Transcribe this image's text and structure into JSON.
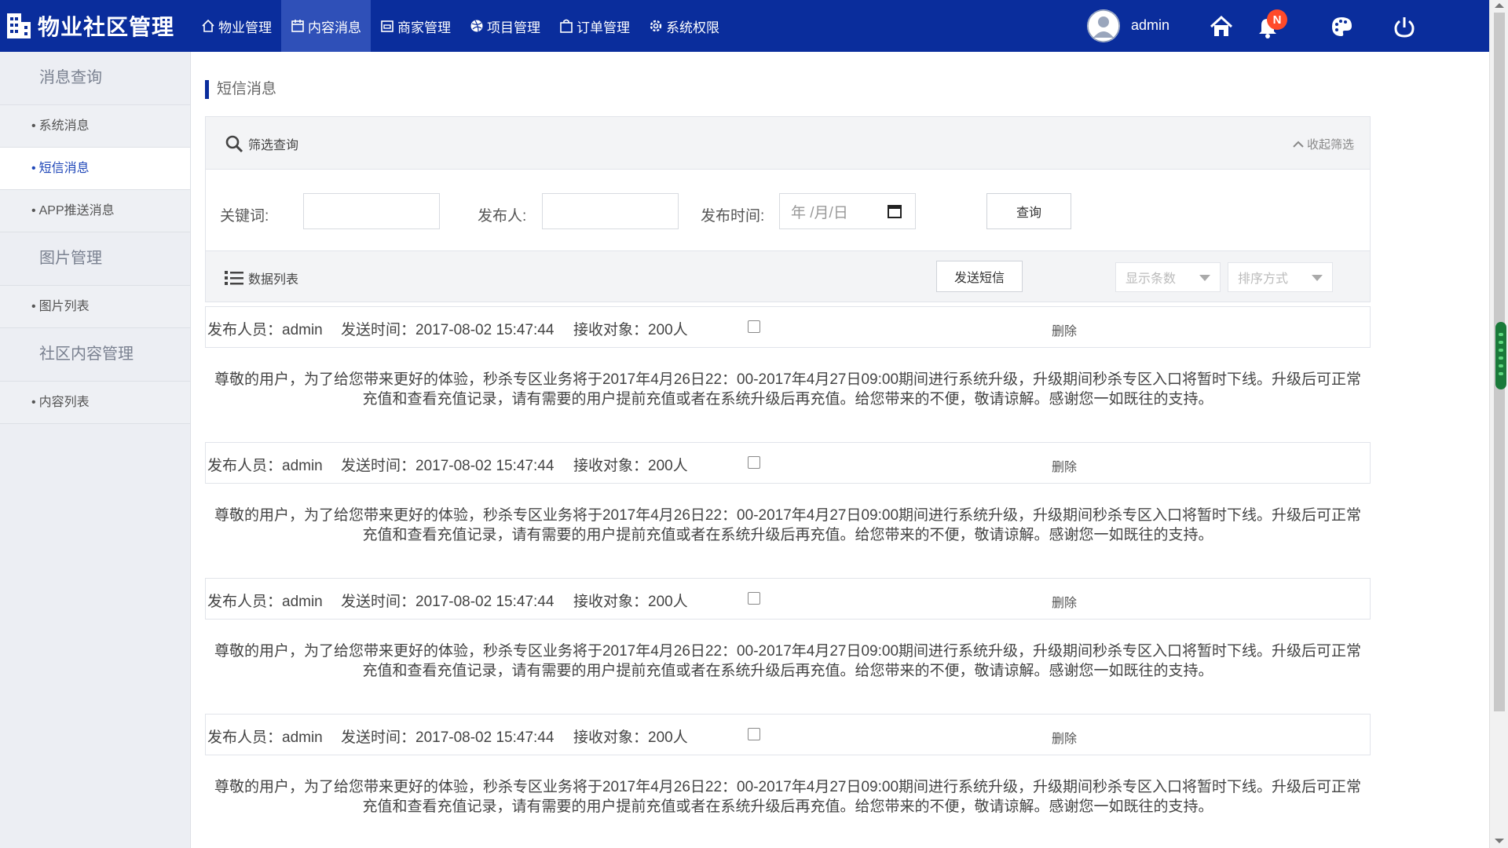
{
  "brand": {
    "title": "物业社区管理"
  },
  "nav": [
    {
      "label": "物业管理",
      "icon": "home-outline-icon"
    },
    {
      "label": "内容消息",
      "icon": "calendar-icon",
      "active": true
    },
    {
      "label": "商家管理",
      "icon": "store-icon"
    },
    {
      "label": "项目管理",
      "icon": "dribbble-icon"
    },
    {
      "label": "订单管理",
      "icon": "bag-icon"
    },
    {
      "label": "系统权限",
      "icon": "gear-icon"
    }
  ],
  "user": {
    "name": "admin",
    "badge": "N"
  },
  "sidebar": {
    "groups": [
      {
        "title": "消息查询",
        "items": [
          "系统消息",
          "短信消息",
          "APP推送消息"
        ]
      },
      {
        "title": "图片管理",
        "items": [
          "图片列表"
        ]
      },
      {
        "title": "社区内容管理",
        "items": [
          "内容列表"
        ]
      }
    ],
    "active_item": "短信消息",
    "bullet": "•"
  },
  "page": {
    "title": "短信消息"
  },
  "filter": {
    "title": "筛选查询",
    "collapse_label": "收起筛选",
    "keyword_label": "关键词:",
    "keyword_value": "",
    "publisher_label": "发布人:",
    "publisher_value": "",
    "date_label": "发布时间:",
    "date_placeholder": "年 /月/日",
    "query_button": "查询"
  },
  "list": {
    "title": "数据列表",
    "send_button": "发送短信",
    "page_size_placeholder": "显示条数",
    "sort_placeholder": "排序方式"
  },
  "messages": [
    {
      "publisher": "发布人员：admin",
      "send_time": "发送时间：2017-08-02 15:47:44",
      "receivers": "接收对象：200人",
      "delete_label": "删除",
      "content": "尊敬的用户，为了给您带来更好的体验，秒杀专区业务将于2017年4月26日22：00-2017年4月27日09:00期间进行系统升级，升级期间秒杀专区入口将暂时下线。升级后可正常充值和查看充值记录，请有需要的用户提前充值或者在系统升级后再充值。给您带来的不便，敬请谅解。感谢您一如既往的支持。"
    },
    {
      "publisher": "发布人员：admin",
      "send_time": "发送时间：2017-08-02 15:47:44",
      "receivers": "接收对象：200人",
      "delete_label": "删除",
      "content": "尊敬的用户，为了给您带来更好的体验，秒杀专区业务将于2017年4月26日22：00-2017年4月27日09:00期间进行系统升级，升级期间秒杀专区入口将暂时下线。升级后可正常充值和查看充值记录，请有需要的用户提前充值或者在系统升级后再充值。给您带来的不便，敬请谅解。感谢您一如既往的支持。"
    },
    {
      "publisher": "发布人员：admin",
      "send_time": "发送时间：2017-08-02 15:47:44",
      "receivers": "接收对象：200人",
      "delete_label": "删除",
      "content": "尊敬的用户，为了给您带来更好的体验，秒杀专区业务将于2017年4月26日22：00-2017年4月27日09:00期间进行系统升级，升级期间秒杀专区入口将暂时下线。升级后可正常充值和查看充值记录，请有需要的用户提前充值或者在系统升级后再充值。给您带来的不便，敬请谅解。感谢您一如既往的支持。"
    },
    {
      "publisher": "发布人员：admin",
      "send_time": "发送时间：2017-08-02 15:47:44",
      "receivers": "接收对象：200人",
      "delete_label": "删除",
      "content": "尊敬的用户，为了给您带来更好的体验，秒杀专区业务将于2017年4月26日22：00-2017年4月27日09:00期间进行系统升级，升级期间秒杀专区入口将暂时下线。升级后可正常充值和查看充值记录，请有需要的用户提前充值或者在系统升级后再充值。给您带来的不便，敬请谅解。感谢您一如既往的支持。"
    }
  ],
  "colors": {
    "nav_bg": "#0a2d9c",
    "nav_active": "#2f50b8",
    "accent": "#1e46b8",
    "badge": "#ff4a2a"
  }
}
